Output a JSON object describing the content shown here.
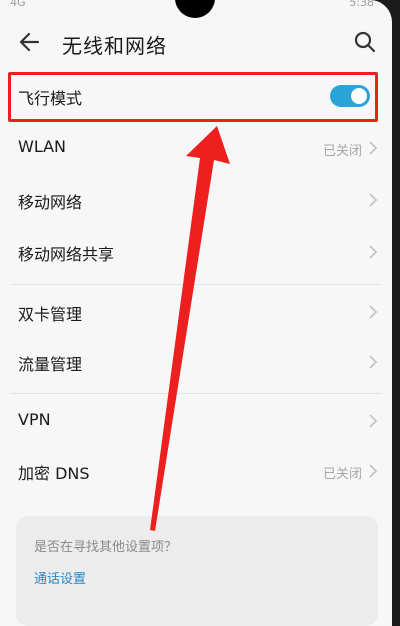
{
  "status_bar": {
    "left": "4G",
    "right": "5:38"
  },
  "header": {
    "title": "无线和网络"
  },
  "rows": {
    "airplane": {
      "label": "飞行模式",
      "toggle_on": true
    },
    "wlan": {
      "label": "WLAN",
      "status": "已关闭"
    },
    "mobile_network": {
      "label": "移动网络"
    },
    "tethering": {
      "label": "移动网络共享"
    },
    "dual_sim": {
      "label": "双卡管理"
    },
    "data_usage": {
      "label": "流量管理"
    },
    "vpn": {
      "label": "VPN"
    },
    "private_dns": {
      "label": "加密 DNS",
      "status": "已关闭"
    }
  },
  "suggestion": {
    "question": "是否在寻找其他设置项？",
    "link": "通话设置"
  },
  "colors": {
    "accent": "#2aa3d8",
    "annotation": "#ee1f1f",
    "link": "#2a86c8"
  },
  "icons": [
    "back-arrow-icon",
    "search-icon",
    "chevron-right-icon",
    "toggle-switch"
  ]
}
